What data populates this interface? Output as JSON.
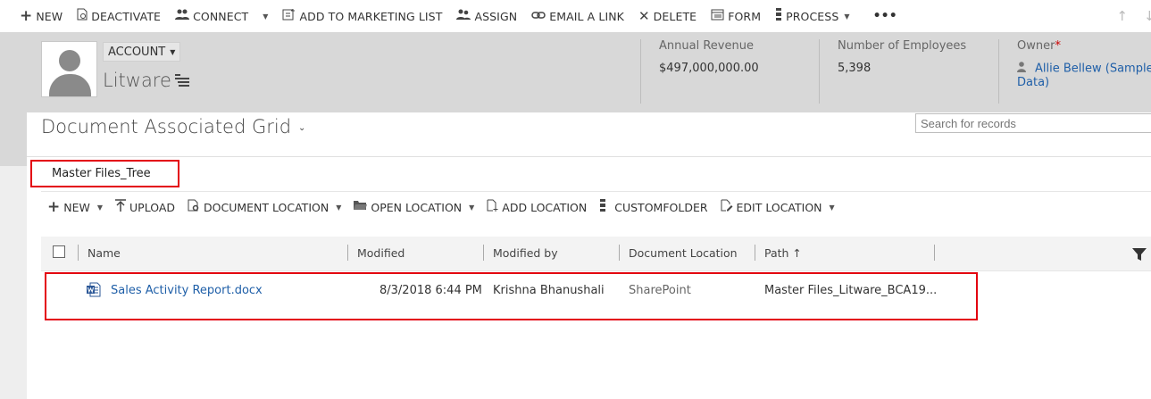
{
  "command_bar": {
    "new": "NEW",
    "deactivate": "DEACTIVATE",
    "connect": "CONNECT",
    "add_to_marketing_list": "ADD TO MARKETING LIST",
    "assign": "ASSIGN",
    "email_a_link": "EMAIL A LINK",
    "delete": "DELETE",
    "form": "FORM",
    "process": "PROCESS",
    "more": "•••"
  },
  "record": {
    "entity_type": "ACCOUNT",
    "name": "Litware",
    "annual_revenue_label": "Annual Revenue",
    "annual_revenue": "$497,000,000.00",
    "employees_label": "Number of Employees",
    "employees": "5,398",
    "owner_label": "Owner",
    "owner_required_mark": "*",
    "owner_line1": "Allie Bellew (Sample",
    "owner_line2": "Data)"
  },
  "grid": {
    "title": "Document Associated Grid",
    "search_placeholder": "Search for records",
    "folder": "Master Files_Tree",
    "toolbar": {
      "new": "NEW",
      "upload": "UPLOAD",
      "document_location": "DOCUMENT LOCATION",
      "open_location": "OPEN LOCATION",
      "add_location": "ADD LOCATION",
      "customfolder": "CUSTOMFOLDER",
      "edit_location": "EDIT LOCATION"
    },
    "columns": {
      "name": "Name",
      "modified": "Modified",
      "modified_by": "Modified by",
      "document_location": "Document Location",
      "path": "Path ↑"
    },
    "rows": [
      {
        "name": "Sales Activity Report.docx",
        "modified": "8/3/2018 6:44 PM",
        "modified_by": "Krishna Bhanushali",
        "document_location": "SharePoint",
        "path": "Master Files_Litware_BCA19..."
      }
    ]
  },
  "colors": {
    "header_bg": "#d8d8d8",
    "link": "#1f5fa8",
    "highlight": "#e3000f"
  }
}
